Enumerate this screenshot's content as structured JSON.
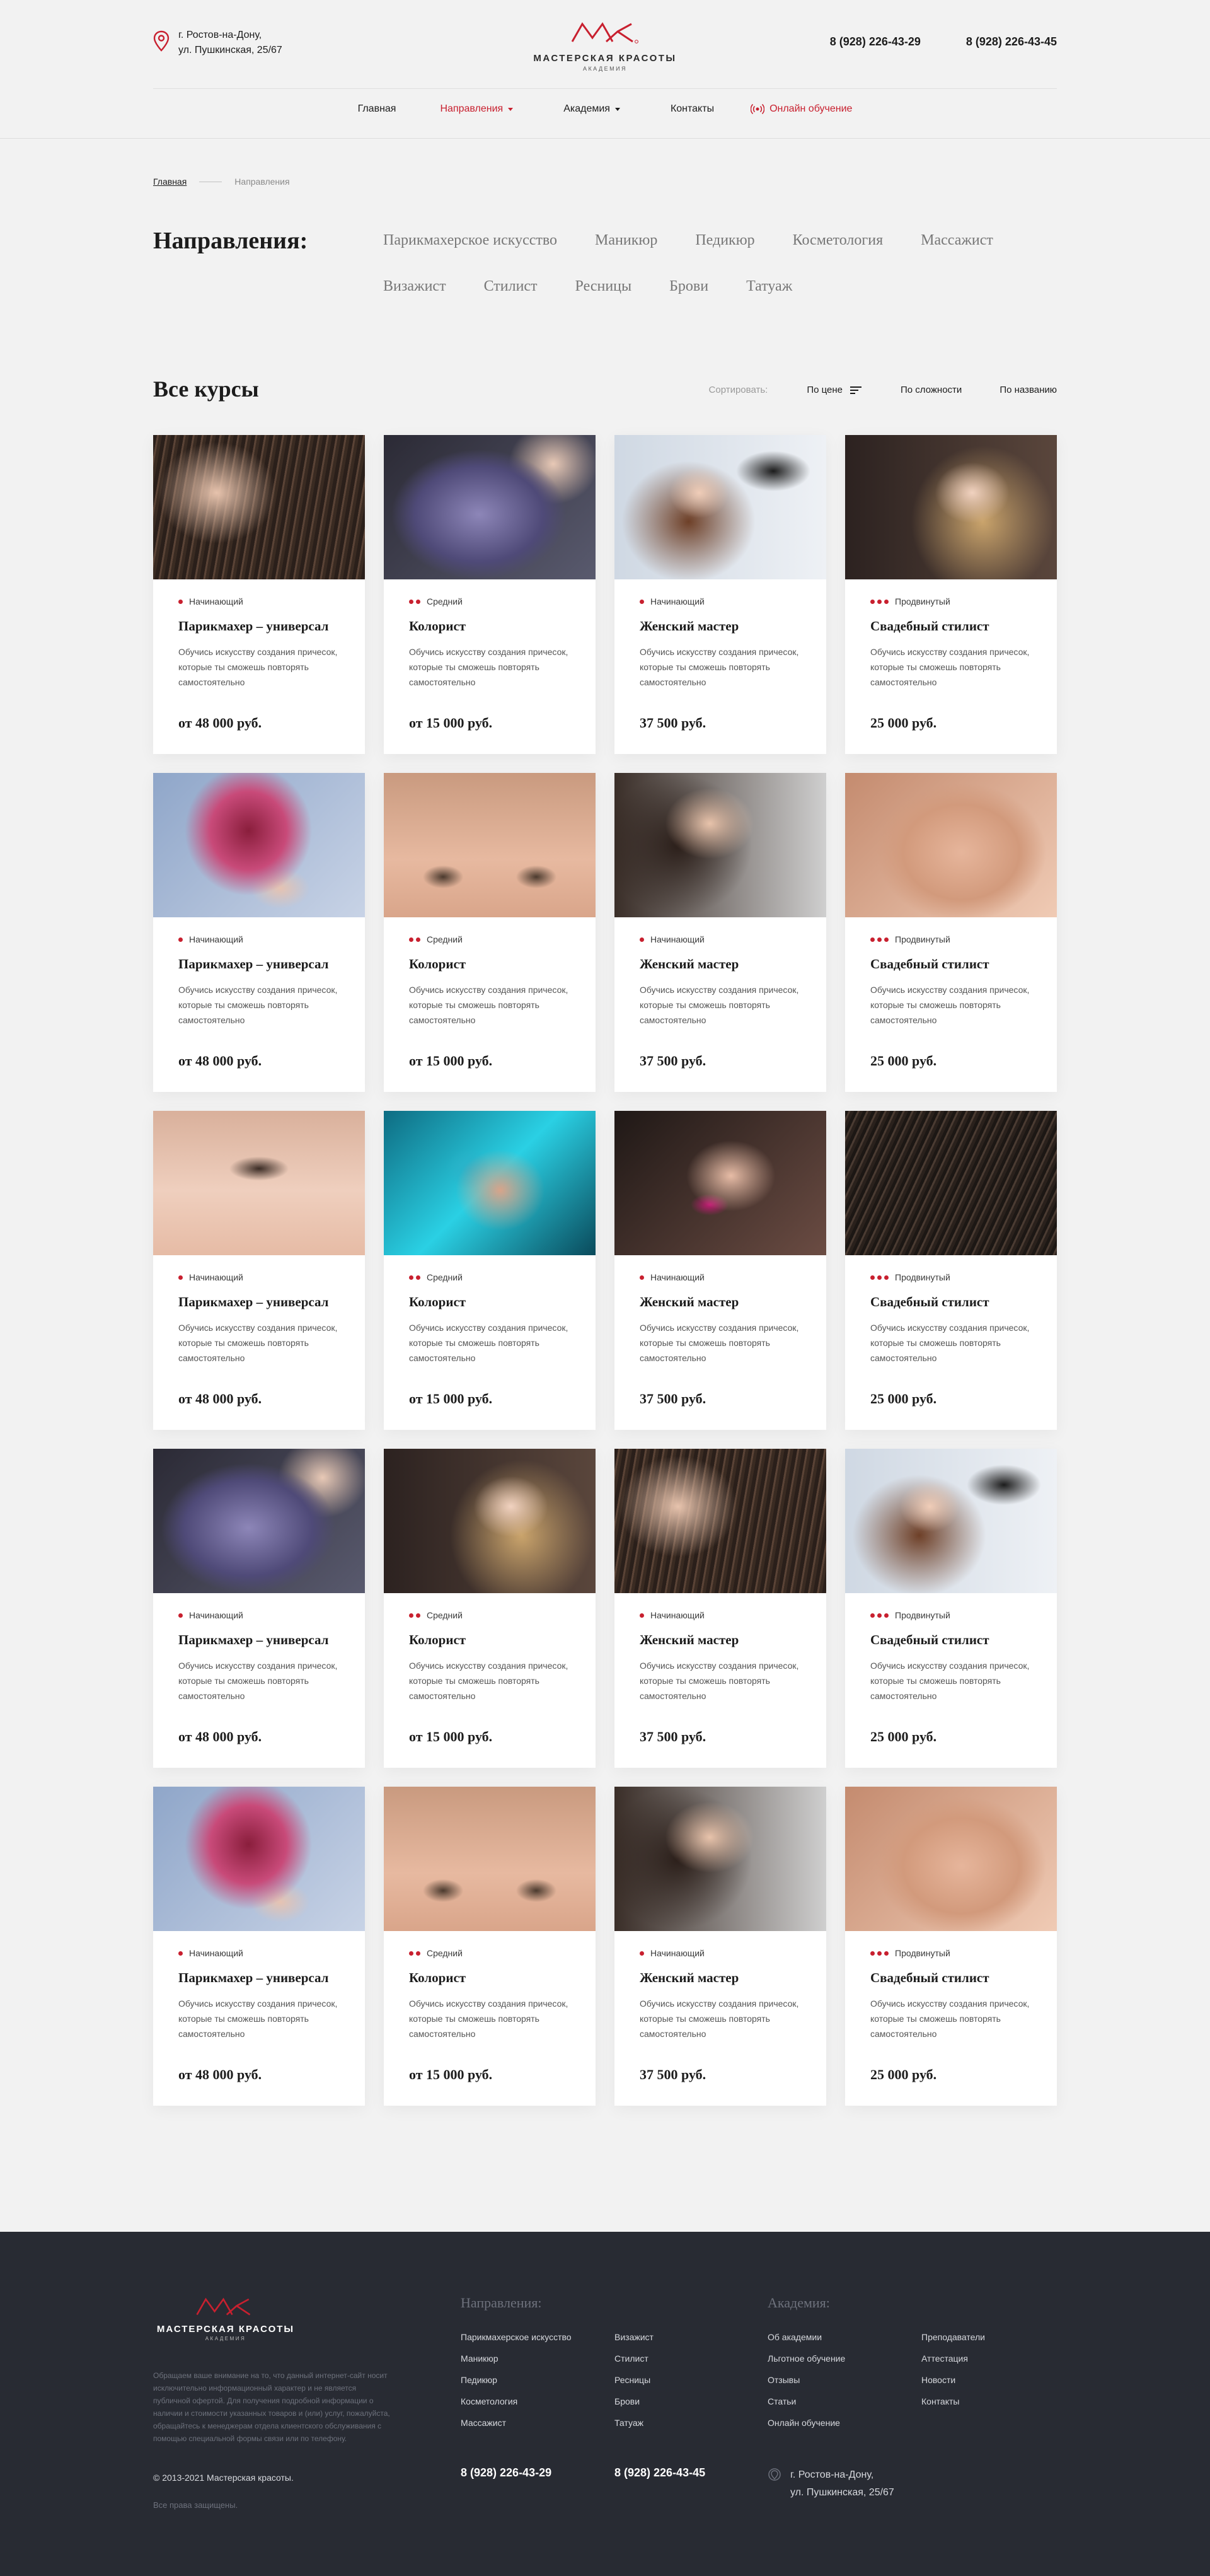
{
  "header": {
    "address_line1": "г. Ростов-на-Дону,",
    "address_line2": "ул. Пушкинская, 25/67",
    "brand_name": "МАСТЕРСКАЯ КРАСОТЫ",
    "brand_sub": "АКАДЕМИЯ",
    "phone1": "8 (928) 226-43-29",
    "phone2": "8 (928) 226-43-45",
    "nav": {
      "home": "Главная",
      "directions": "Направления",
      "academy": "Академия",
      "contacts": "Контакты",
      "online": "Онлайн обучение"
    }
  },
  "colors": {
    "accent": "#c8202f",
    "footer_bg": "#282b33",
    "page_bg": "#f2f2f2"
  },
  "breadcrumb": {
    "home": "Главная",
    "current": "Направления"
  },
  "directions": {
    "title": "Направления:",
    "items": [
      "Парикмахерское искусство",
      "Маникюр",
      "Педикюр",
      "Косметология",
      "Массажист",
      "Визажист",
      "Стилист",
      "Ресницы",
      "Брови",
      "Татуаж"
    ]
  },
  "courses": {
    "title": "Все курсы",
    "sort_label": "Сортировать:",
    "sort_price": "По цене",
    "sort_difficulty": "По сложности",
    "sort_name": "По названию"
  },
  "cards": [
    {
      "level": "Начинающий",
      "dots": 1,
      "title": "Парикмахер – универсал",
      "desc": "Обучись искусству создания причесок, которые ты сможешь повторять самостоятельно",
      "price": "от 48 000 руб.",
      "image": "haircut-comb-photo"
    },
    {
      "level": "Средний",
      "dots": 2,
      "title": "Колорист",
      "desc": "Обучись искусству создания причесок, которые ты сможешь повторять самостоятельно",
      "price": "от 15 000 руб.",
      "image": "purple-hair-photo"
    },
    {
      "level": "Начинающий",
      "dots": 1,
      "title": "Женский мастер",
      "desc": "Обучись искусству создания причесок, которые ты сможешь повторять самостоятельно",
      "price": "37 500 руб.",
      "image": "hair-dryer-photo"
    },
    {
      "level": "Продвинутый",
      "dots": 3,
      "title": "Свадебный стилист",
      "desc": "Обучись искусству создания причесок, которые ты сможешь повторять самостоятельно",
      "price": "25 000 руб.",
      "image": "bride-makeup-photo"
    },
    {
      "level": "Начинающий",
      "dots": 1,
      "title": "Парикмахер – универсал",
      "desc": "Обучись искусству создания причесок, которые ты сможешь повторять самостоятельно",
      "price": "от 48 000 руб.",
      "image": "colored-bob-photo"
    },
    {
      "level": "Средний",
      "dots": 2,
      "title": "Колорист",
      "desc": "Обучись искусству создания причесок, которые ты сможешь повторять самостоятельно",
      "price": "от 15 000 руб.",
      "image": "eyebrows-photo"
    },
    {
      "level": "Начинающий",
      "dots": 1,
      "title": "Женский мастер",
      "desc": "Обучись искусству создания причесок, которые ты сможешь повторять самостоятельно",
      "price": "37 500 руб.",
      "image": "lip-makeup-photo"
    },
    {
      "level": "Продвинутый",
      "dots": 3,
      "title": "Свадебный стилист",
      "desc": "Обучись искусству создания причесок, которые ты сможешь повторять самостоятельно",
      "price": "25 000 руб.",
      "image": "lash-extension-photo"
    },
    {
      "level": "Начинающий",
      "dots": 1,
      "title": "Парикмахер – универсал",
      "desc": "Обучись искусству создания причесок, которые ты сможешь повторять самостоятельно",
      "price": "от 48 000 руб.",
      "image": "lash-brush-photo"
    },
    {
      "level": "Средний",
      "dots": 2,
      "title": "Колорист",
      "desc": "Обучись искусству создания причесок, которые ты сможешь повторять самостоятельно",
      "price": "от 15 000 руб.",
      "image": "nail-art-photo"
    },
    {
      "level": "Начинающий",
      "dots": 1,
      "title": "Женский мастер",
      "desc": "Обучись искусству создания причесок, которые ты сможешь повторять самостоятельно",
      "price": "37 500 руб.",
      "image": "pink-nails-photo"
    },
    {
      "level": "Продвинутый",
      "dots": 3,
      "title": "Свадебный стилист",
      "desc": "Обучись искусству создания причесок, которые ты сможешь повторять самостоятельно",
      "price": "25 000 руб.",
      "image": "hair-strands-photo"
    },
    {
      "level": "Начинающий",
      "dots": 1,
      "title": "Парикмахер – универсал",
      "desc": "Обучись искусству создания причесок, которые ты сможешь повторять самостоятельно",
      "price": "от 48 000 руб.",
      "image": "purple-hair-photo"
    },
    {
      "level": "Средний",
      "dots": 2,
      "title": "Колорист",
      "desc": "Обучись искусству создания причесок, которые ты сможешь повторять самостоятельно",
      "price": "от 15 000 руб.",
      "image": "bride-makeup-photo"
    },
    {
      "level": "Начинающий",
      "dots": 1,
      "title": "Женский мастер",
      "desc": "Обучись искусству создания причесок, которые ты сможешь повторять самостоятельно",
      "price": "37 500 руб.",
      "image": "haircut-comb-photo"
    },
    {
      "level": "Продвинутый",
      "dots": 3,
      "title": "Свадебный стилист",
      "desc": "Обучись искусству создания причесок, которые ты сможешь повторять самостоятельно",
      "price": "25 000 руб.",
      "image": "hair-dryer-photo"
    },
    {
      "level": "Начинающий",
      "dots": 1,
      "title": "Парикмахер – универсал",
      "desc": "Обучись искусству создания причесок, которые ты сможешь повторять самостоятельно",
      "price": "от 48 000 руб.",
      "image": "colored-bob-photo"
    },
    {
      "level": "Средний",
      "dots": 2,
      "title": "Колорист",
      "desc": "Обучись искусству создания причесок, которые ты сможешь повторять самостоятельно",
      "price": "от 15 000 руб.",
      "image": "eyebrows-photo"
    },
    {
      "level": "Начинающий",
      "dots": 1,
      "title": "Женский мастер",
      "desc": "Обучись искусству создания причесок, которые ты сможешь повторять самостоятельно",
      "price": "37 500 руб.",
      "image": "lip-makeup-photo"
    },
    {
      "level": "Продвинутый",
      "dots": 3,
      "title": "Свадебный стилист",
      "desc": "Обучись искусству создания причесок, которые ты сможешь повторять самостоятельно",
      "price": "25 000 руб.",
      "image": "lash-extension-photo"
    }
  ],
  "footer": {
    "brand_name": "МАСТЕРСКАЯ КРАСОТЫ",
    "brand_sub": "АКАДЕМИЯ",
    "note": "Обращаем ваше внимание на то, что данный интернет-сайт носит исключительно информационный характер и не является публичной офертой. Для получения подробной информации о наличии и стоимости указанных товаров и (или) услуг, пожалуйста, обращайтесь к менеджерам отдела клиентского обслуживания с помощью специальной формы связи или по телефону.",
    "copyright": "© 2013-2021 Мастерская красоты.",
    "rights": "Все права защищены.",
    "directions_title": "Направления:",
    "directions_col1": [
      "Парикмахерское искусство",
      "Маникюр",
      "Педикюр",
      "Косметология",
      "Массажист"
    ],
    "directions_col2": [
      "Визажист",
      "Стилист",
      "Ресницы",
      "Брови",
      "Татуаж"
    ],
    "academy_title": "Академия:",
    "academy_col1": [
      "Об академии",
      "Льготное обучение",
      "Отзывы",
      "Статьи",
      "Онлайн обучение"
    ],
    "academy_col2": [
      "Преподаватели",
      "Аттестация",
      "Новости",
      "Контакты"
    ],
    "phone1": "8 (928) 226-43-29",
    "phone2": "8 (928) 226-43-45",
    "address_line1": "г. Ростов-на-Дону,",
    "address_line2": "ул. Пушкинская, 25/67"
  }
}
